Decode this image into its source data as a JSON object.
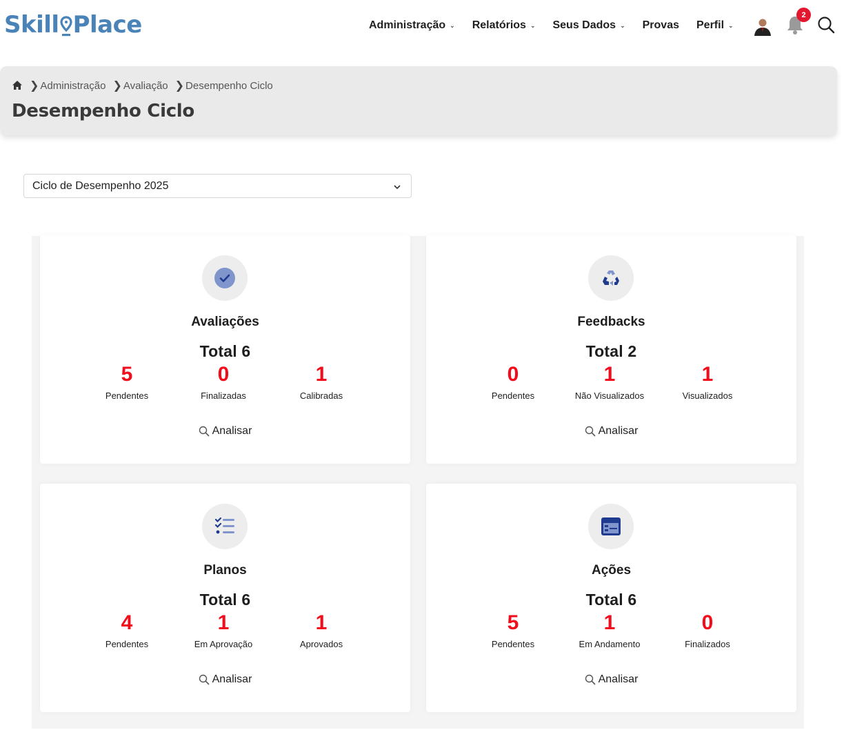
{
  "brand": {
    "logo_left": "Skill",
    "logo_right": "Place",
    "color": "#4a83b8"
  },
  "nav": {
    "items": [
      {
        "label": "Administração",
        "has_dropdown": true
      },
      {
        "label": "Relatórios",
        "has_dropdown": true
      },
      {
        "label": "Seus Dados",
        "has_dropdown": true
      },
      {
        "label": "Provas",
        "has_dropdown": false
      },
      {
        "label": "Perfil",
        "has_dropdown": true
      }
    ],
    "notification_count": "2",
    "icons": [
      "avatar",
      "bell-icon",
      "search-icon"
    ]
  },
  "breadcrumb": {
    "items": [
      "Administração",
      "Avaliação",
      "Desempenho Ciclo"
    ]
  },
  "page": {
    "title": "Desempenho Ciclo",
    "cycle_select": {
      "value": "Ciclo de Desempenho 2025"
    }
  },
  "cards": [
    {
      "title": "Avaliações",
      "total": "Total 6",
      "icon": "check-circle-icon",
      "stats": [
        {
          "value": "5",
          "label": "Pendentes"
        },
        {
          "value": "0",
          "label": "Finalizadas"
        },
        {
          "value": "1",
          "label": "Calibradas"
        }
      ],
      "action": "Analisar"
    },
    {
      "title": "Feedbacks",
      "total": "Total 2",
      "icon": "recycle-icon",
      "stats": [
        {
          "value": "0",
          "label": "Pendentes"
        },
        {
          "value": "1",
          "label": "Não Visualizados"
        },
        {
          "value": "1",
          "label": "Visualizados"
        }
      ],
      "action": "Analisar"
    },
    {
      "title": "Planos",
      "total": "Total 6",
      "icon": "checklist-icon",
      "stats": [
        {
          "value": "4",
          "label": "Pendentes"
        },
        {
          "value": "1",
          "label": "Em Aprovação"
        },
        {
          "value": "1",
          "label": "Aprovados"
        }
      ],
      "action": "Analisar"
    },
    {
      "title": "Ações",
      "total": "Total 6",
      "icon": "window-list-icon",
      "stats": [
        {
          "value": "5",
          "label": "Pendentes"
        },
        {
          "value": "1",
          "label": "Em Andamento"
        },
        {
          "value": "0",
          "label": "Finalizados"
        }
      ],
      "action": "Analisar"
    }
  ],
  "colors": {
    "accent_red": "#f20d1c",
    "icon_blue": "#1f3b8f",
    "icon_light": "#7f95cc"
  }
}
